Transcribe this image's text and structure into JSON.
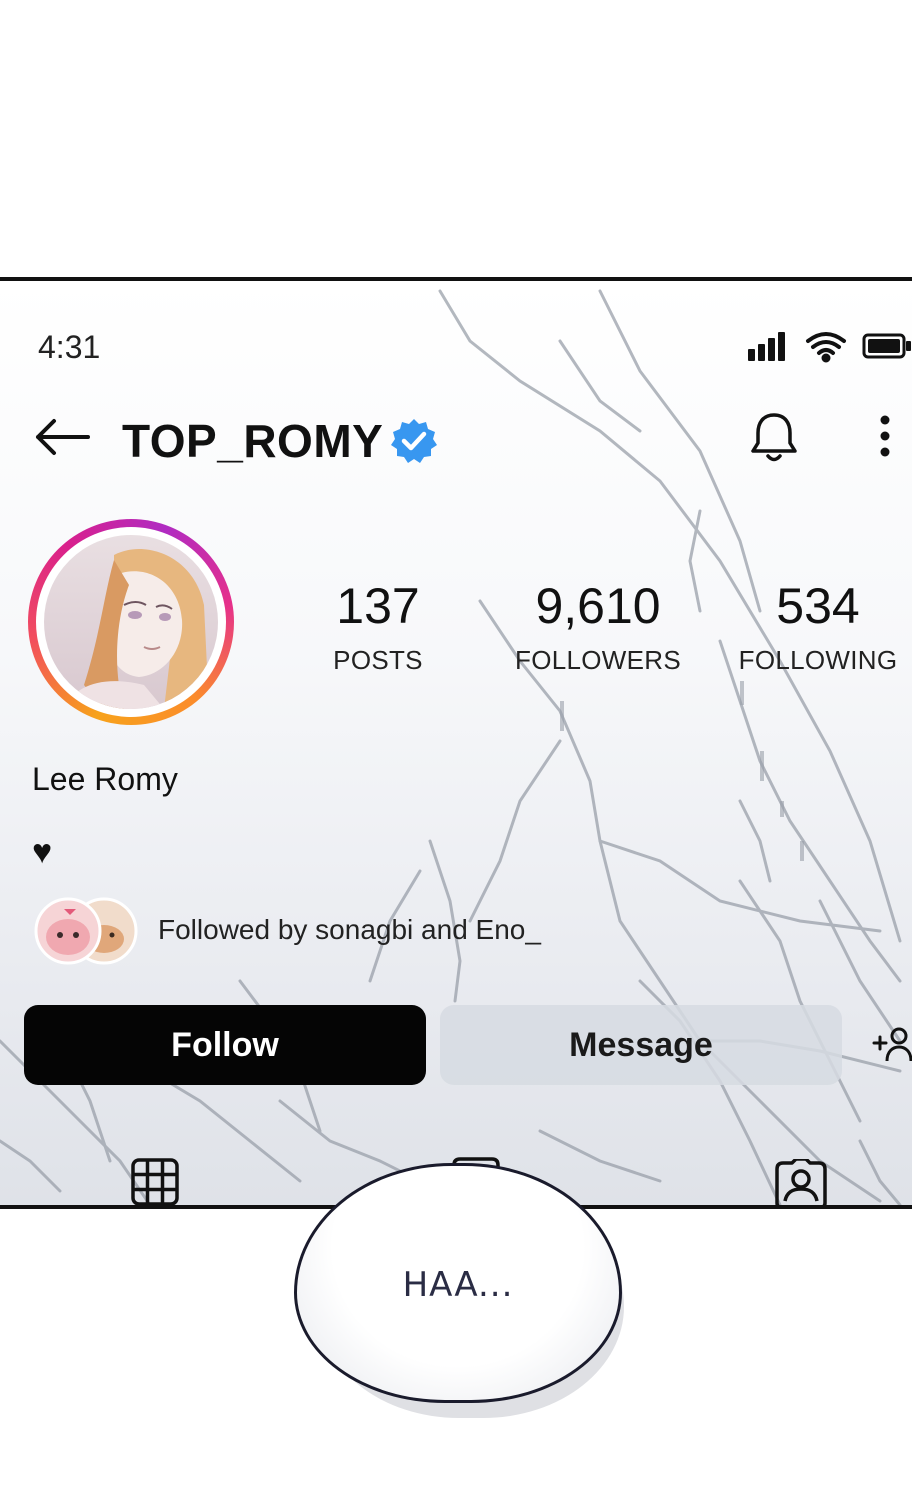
{
  "status_bar": {
    "time": "4:31",
    "icons": [
      "cellular-signal-icon",
      "wifi-icon",
      "battery-icon"
    ]
  },
  "header": {
    "back_icon": "back-arrow-icon",
    "username": "TOP_ROMY",
    "verified": true,
    "verified_color": "#3897f0",
    "actions": [
      "bell-icon",
      "more-vertical-icon"
    ]
  },
  "profile": {
    "display_name": "Lee Romy",
    "bio": "♥",
    "avatar_ring_colors": [
      "#f7a21b",
      "#f24e5d",
      "#d9208c",
      "#b02bc2"
    ]
  },
  "stats": {
    "posts": {
      "value": "137",
      "label": "POSTS"
    },
    "followers": {
      "value": "9,610",
      "label": "FOLLOWERS"
    },
    "following": {
      "value": "534",
      "label": "FOLLOWING"
    }
  },
  "mutuals": {
    "text": "Followed by sonagbi and Eno_"
  },
  "actions": {
    "follow_label": "Follow",
    "message_label": "Message",
    "add_friend_icon": "add-person-icon"
  },
  "tabs": [
    "grid-icon",
    "reels-icon",
    "tagged-icon"
  ],
  "speech_bubble": {
    "text": "HAA..."
  }
}
